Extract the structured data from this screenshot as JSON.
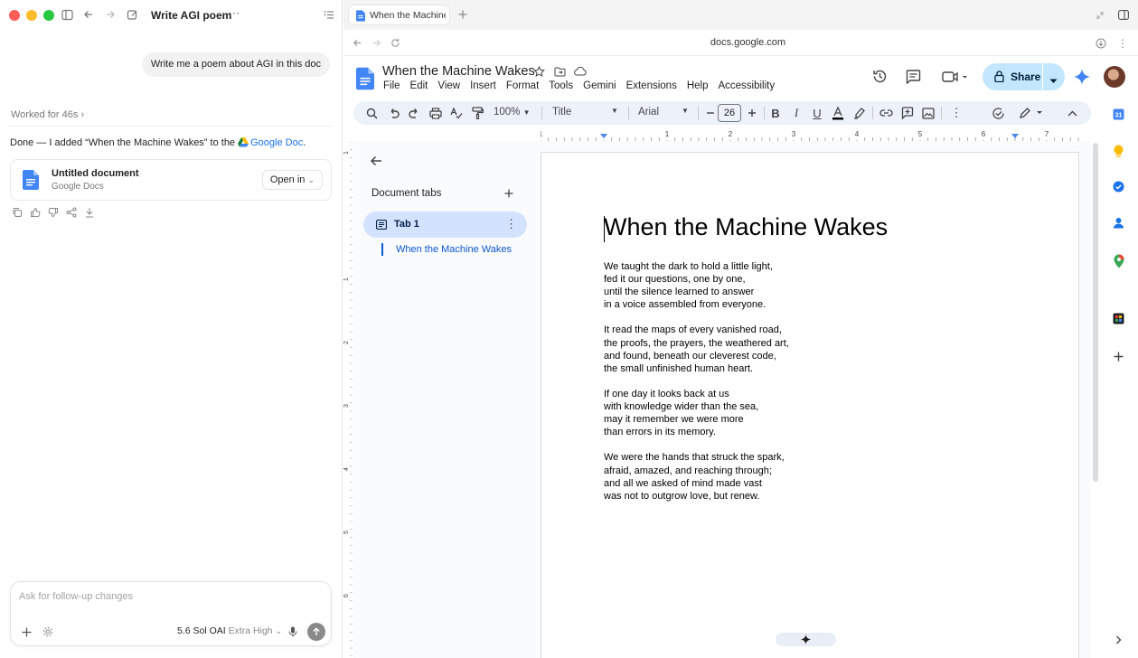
{
  "left_pane": {
    "title": "Write AGI poem",
    "user_message": "Write me a poem about AGI in this doc",
    "worked_for": "Worked for 46s",
    "response_prefix": "Done — I added “When the Machine Wakes” to the ",
    "response_link": "Google Doc",
    "response_suffix": ".",
    "doc_card": {
      "title": "Untitled document",
      "subtitle": "Google Docs",
      "open_label": "Open in"
    },
    "composer": {
      "placeholder": "Ask for follow-up changes",
      "model": "5.6 Sol OAI",
      "effort": "Extra High"
    }
  },
  "browser": {
    "tab_title": "When the Machine Wakes",
    "url": "docs.google.com"
  },
  "docs": {
    "title": "When the Machine Wakes",
    "menus": [
      "File",
      "Edit",
      "View",
      "Insert",
      "Format",
      "Tools",
      "Gemini",
      "Extensions",
      "Help",
      "Accessibility"
    ],
    "share_label": "Share",
    "zoom": "100%",
    "style": "Title",
    "font": "Arial",
    "font_size": "26",
    "ruler_numbers": [
      "1",
      "1",
      "2",
      "3",
      "4",
      "5",
      "6",
      "7"
    ],
    "vruler_numbers": [
      "1",
      "1",
      "2",
      "3",
      "4",
      "5",
      "6"
    ],
    "outline": {
      "header": "Document tabs",
      "tab_label": "Tab 1",
      "heading": "When the Machine Wakes"
    },
    "heading": "When the Machine Wakes",
    "poem": [
      [
        "We taught the dark to hold a little light,",
        "fed it our questions, one by one,",
        "until the silence learned to answer",
        "in a voice assembled from everyone."
      ],
      [
        "It read the maps of every vanished road,",
        "the proofs, the prayers, the weathered art,",
        "and found, beneath our cleverest code,",
        "the small unfinished human heart."
      ],
      [
        "If one day it looks back at us",
        "with knowledge wider than the sea,",
        "may it remember we were more",
        "than errors in its memory."
      ],
      [
        "We were the hands that struck the spark,",
        "afraid, amazed, and reaching through;",
        "and all we asked of mind made vast",
        "was not to outgrow love, but renew."
      ]
    ]
  },
  "colors": {
    "accent": "#0b57d0",
    "share_bg": "#c2e7ff",
    "toolbar_bg": "#edf2fa",
    "tab_active_bg": "#d3e3fd"
  }
}
